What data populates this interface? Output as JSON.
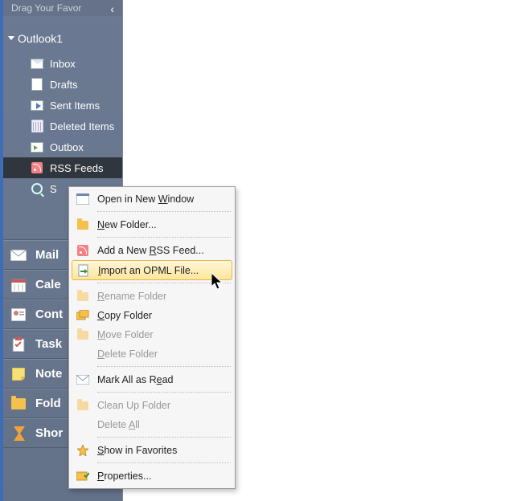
{
  "header": {
    "drag_text": "Drag Your Favor"
  },
  "account": {
    "name": "Outlook1"
  },
  "folders": [
    {
      "key": "inbox",
      "label": "Inbox",
      "icon": "mail"
    },
    {
      "key": "drafts",
      "label": "Drafts",
      "icon": "draft"
    },
    {
      "key": "sent",
      "label": "Sent Items",
      "icon": "sent"
    },
    {
      "key": "deleted",
      "label": "Deleted Items",
      "icon": "trash"
    },
    {
      "key": "outbox",
      "label": "Outbox",
      "icon": "out"
    },
    {
      "key": "rss",
      "label": "RSS Feeds",
      "icon": "rss",
      "selected": true
    },
    {
      "key": "search",
      "label": "S",
      "icon": "search"
    }
  ],
  "nav": [
    {
      "key": "mail",
      "label": "Mail"
    },
    {
      "key": "calendar",
      "label": "Cale"
    },
    {
      "key": "contacts",
      "label": "Cont"
    },
    {
      "key": "tasks",
      "label": "Task"
    },
    {
      "key": "notes",
      "label": "Note"
    },
    {
      "key": "folders",
      "label": "Fold"
    },
    {
      "key": "shortcuts",
      "label": "Shor"
    }
  ],
  "context_menu": {
    "open_new_window": "Open in New Window",
    "new_folder": "New Folder...",
    "add_rss": "Add a New RSS Feed...",
    "import_opml": "Import an OPML File...",
    "rename": "Rename Folder",
    "copy": "Copy Folder",
    "move": "Move Folder",
    "delete": "Delete Folder",
    "mark_read": "Mark All as Read",
    "clean_up": "Clean Up Folder",
    "delete_all": "Delete All",
    "favorites": "Show in Favorites",
    "properties": "Properties..."
  }
}
